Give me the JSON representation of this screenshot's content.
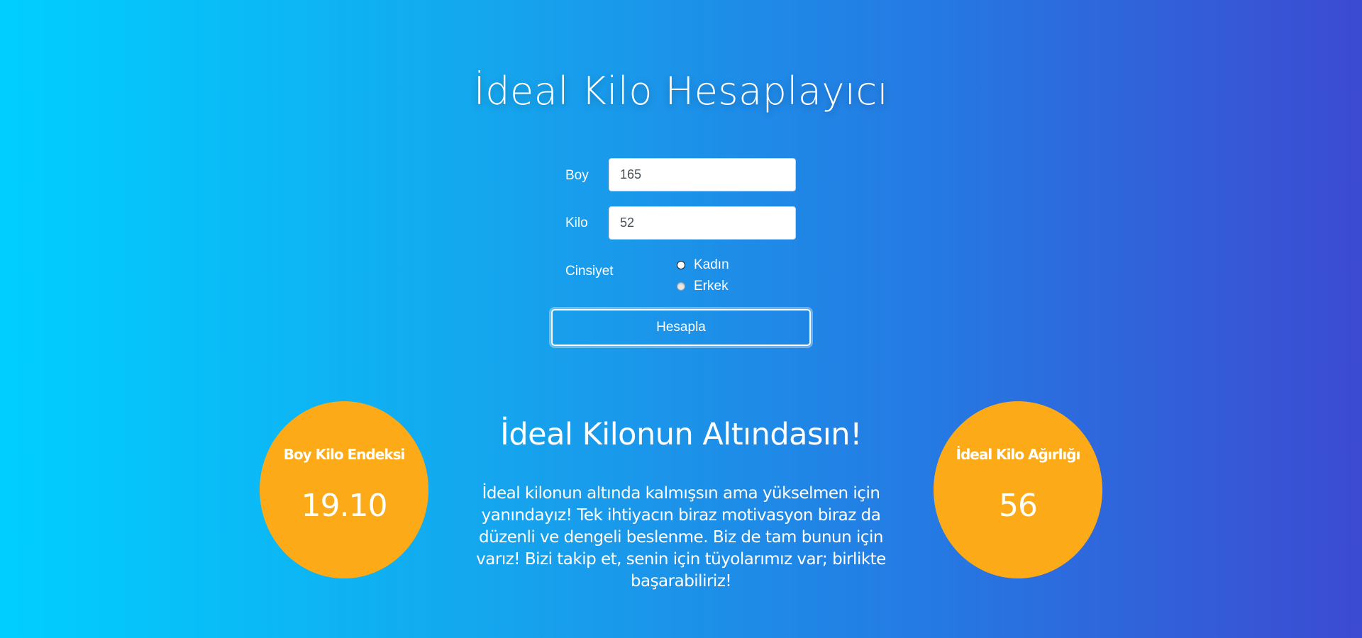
{
  "page": {
    "title": "İdeal Kilo Hesaplayıcı"
  },
  "form": {
    "height_label": "Boy",
    "height_value": "165",
    "weight_label": "Kilo",
    "weight_value": "52",
    "gender_label": "Cinsiyet",
    "gender_options": [
      {
        "label": "Kadın",
        "checked": false
      },
      {
        "label": "Erkek",
        "checked": true
      }
    ],
    "submit_label": "Hesapla"
  },
  "results": {
    "bmi": {
      "title": "Boy Kilo Endeksi",
      "value": "19.10"
    },
    "ideal_weight": {
      "title": "İdeal Kilo Ağırlığı",
      "value": "56"
    },
    "heading": "İdeal Kilonun Altındasın!",
    "message": "İdeal kilonun altında kalmışsın ama yükselmen için yanındayız! Tek ihtiyacın biraz motivasyon biraz da düzenli ve dengeli beslenme. Biz de tam bunun için varız! Bizi takip et, senin için tüyolarımız var; birlikte başarabiliriz!"
  },
  "colors": {
    "gradient_start": "#00cffe",
    "gradient_end": "#3c4bd2",
    "circle_fill": "#fcaa17",
    "text": "#ffffff"
  }
}
